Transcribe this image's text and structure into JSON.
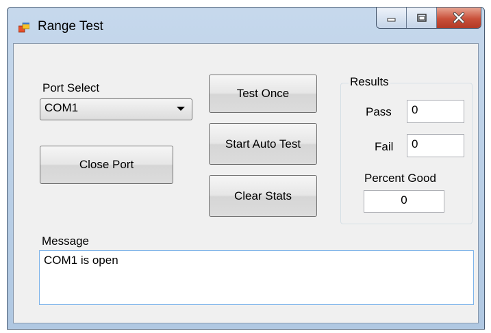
{
  "window": {
    "title": "Range Test"
  },
  "port": {
    "label": "Port Select",
    "selected": "COM1",
    "close_button": "Close Port"
  },
  "actions": {
    "test_once": "Test Once",
    "start_auto_test": "Start Auto Test",
    "clear_stats": "Clear Stats"
  },
  "results": {
    "title": "Results",
    "pass_label": "Pass",
    "pass_value": "0",
    "fail_label": "Fail",
    "fail_value": "0",
    "percent_label": "Percent Good",
    "percent_value": "0"
  },
  "message": {
    "label": "Message",
    "text": "COM1 is open"
  },
  "colors": {
    "titlebar": "#b9cfe8",
    "client_background": "#f0f0f0",
    "close_button": "#c9503a",
    "textbox_focus_border": "#7eb4ea"
  },
  "icons": {
    "app": "app-window-icon",
    "minimize": "minimize-icon",
    "maximize": "maximize-icon",
    "close": "close-icon",
    "dropdown": "chevron-down-icon"
  }
}
